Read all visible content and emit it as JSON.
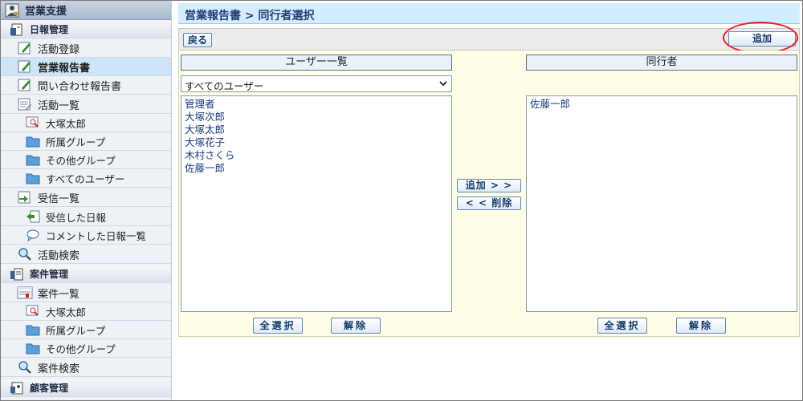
{
  "sidebar": {
    "app_title": "営業支援",
    "sections": [
      {
        "label": "日報管理",
        "items": [
          {
            "label": "活動登録",
            "icon": "pencil-form-icon",
            "sub": []
          },
          {
            "label": "営業報告書",
            "icon": "pencil-form-icon",
            "sub": [],
            "active": true
          },
          {
            "label": "問い合わせ報告書",
            "icon": "pencil-form-icon",
            "sub": []
          }
        ]
      }
    ],
    "daily": {
      "register": "活動登録",
      "report": "営業報告書",
      "inquiry": "問い合わせ報告書",
      "activity_list": "活動一覧",
      "activity_list_sub": [
        "大塚太郎",
        "所属グループ",
        "その他グループ",
        "すべてのユーザー"
      ],
      "inbox": "受信一覧",
      "inbox_sub": [
        "受信した日報",
        "コメントした日報一覧"
      ],
      "search": "活動検索"
    },
    "deals_section": "案件管理",
    "deals": {
      "list": "案件一覧",
      "list_sub": [
        "大塚太郎",
        "所属グループ",
        "その他グループ"
      ],
      "search": "案件検索"
    },
    "customer_section": "顧客管理",
    "daily_section": "日報管理"
  },
  "header": {
    "breadcrumb": "営業報告書 > 同行者選択"
  },
  "toolbar": {
    "back_label": "戻る",
    "add_label": "追加"
  },
  "users_pane": {
    "title": "ユーザー一覧",
    "filter_value": "すべてのユーザー",
    "users": [
      "管理者",
      "大塚次郎",
      "大塚太郎",
      "大塚花子",
      "木村さくら",
      "佐藤一郎"
    ],
    "select_all_label": "全選択",
    "clear_label": "解除"
  },
  "move_buttons": {
    "add_label": "追加 > >",
    "remove_label": "< < 削除"
  },
  "companions_pane": {
    "title": "同行者",
    "users": [
      "佐藤一郎"
    ],
    "select_all_label": "全選択",
    "clear_label": "解除"
  },
  "colors": {
    "title_bg": "#d4ecff",
    "content_bg": "#fffde5",
    "highlight_ellipse": "#e02020",
    "active_item_bg": "#cde5f7"
  }
}
